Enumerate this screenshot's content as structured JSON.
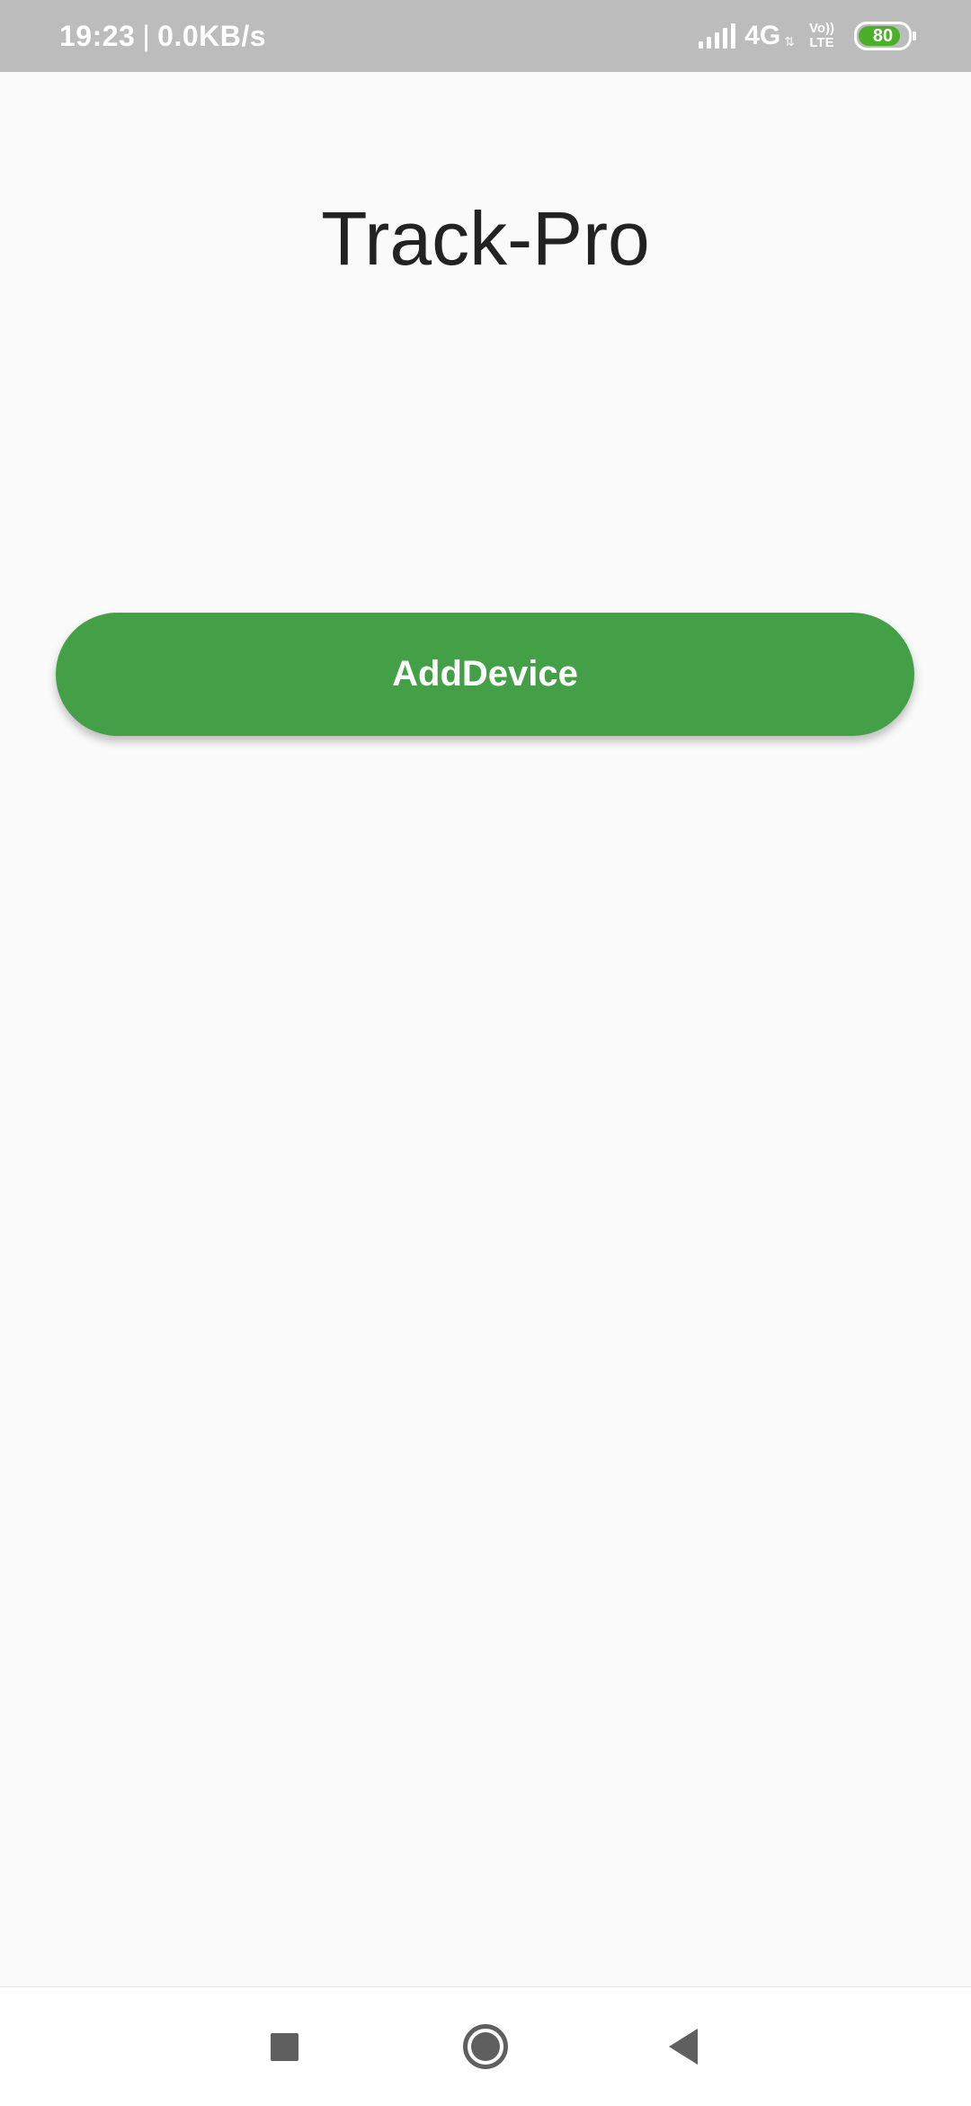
{
  "status_bar": {
    "time": "19:23",
    "separator": "|",
    "net_speed": "0.0KB/s",
    "network_type": "4G",
    "network_arrows": "⇅",
    "volte_top": "Vo))",
    "volte_bottom": "LTE",
    "battery_level": "80",
    "icons": [
      "signal-icon",
      "volte-icon",
      "battery-icon"
    ]
  },
  "app": {
    "title": "Track-Pro"
  },
  "main": {
    "add_device_label": "AddDevice",
    "button_color": "#43a047"
  },
  "nav_bar": {
    "icons": [
      "recents-square-icon",
      "home-circle-icon",
      "back-triangle-icon"
    ]
  }
}
